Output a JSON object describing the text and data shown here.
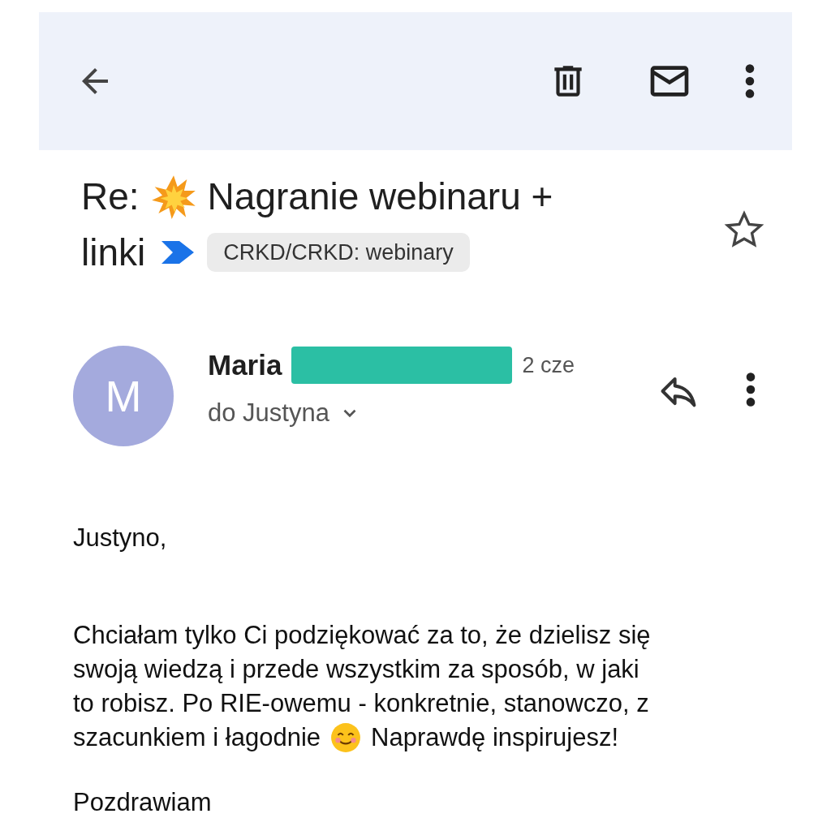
{
  "subject": {
    "prefix": "Re:",
    "title_lines": [
      "Nagranie webinaru +",
      "linki"
    ],
    "label": "CRKD/CRKD: webinary",
    "starred": false
  },
  "message": {
    "avatar_letter": "M",
    "sender": "Maria",
    "date": "2 cze",
    "recipient": "do Justyna"
  },
  "body": {
    "greeting": "Justyno,",
    "lines": [
      "Chciałam tylko Ci podziękować za to, że dzielisz się",
      "swoją wiedzą i przede wszystkim za sposób, w jaki",
      "to robisz. Po RIE-owemu - konkretnie, stanowczo, z",
      "szacunkiem i łagodnie"
    ],
    "text_after": "Naprawdę inspirujesz!",
    "closing": "Pozdrawiam"
  }
}
